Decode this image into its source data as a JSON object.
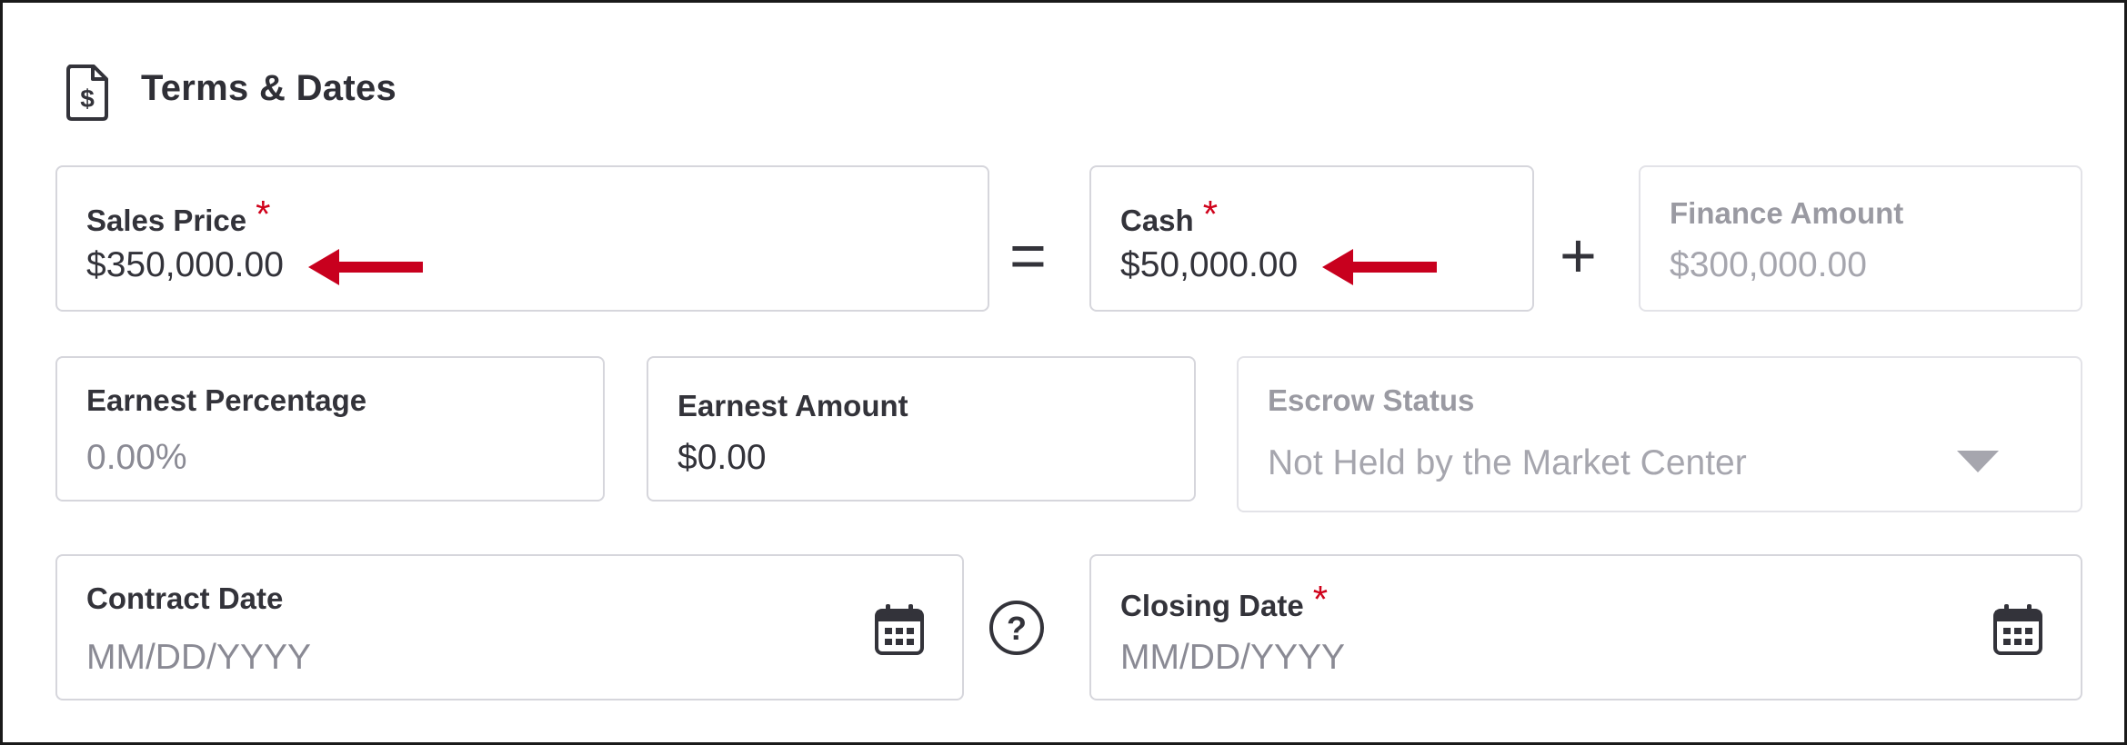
{
  "section": {
    "title": "Terms & Dates",
    "icon": "document-dollar-icon"
  },
  "sales_price": {
    "label": "Sales Price",
    "required_mark": "*",
    "value": "$350,000.00"
  },
  "equals_sign": "=",
  "cash": {
    "label": "Cash",
    "required_mark": "*",
    "value": "$50,000.00"
  },
  "plus_sign": "+",
  "finance_amount": {
    "label": "Finance Amount",
    "value": "$300,000.00"
  },
  "earnest_percentage": {
    "label": "Earnest Percentage",
    "value": "0.00%"
  },
  "earnest_amount": {
    "label": "Earnest Amount",
    "value": "$0.00"
  },
  "escrow_status": {
    "label": "Escrow Status",
    "value": "Not Held by the Market Center"
  },
  "contract_date": {
    "label": "Contract Date",
    "placeholder": "MM/DD/YYYY"
  },
  "help_symbol": "?",
  "closing_date": {
    "label": "Closing Date",
    "required_mark": "*",
    "placeholder": "MM/DD/YYYY"
  },
  "colors": {
    "required": "#d0021b",
    "arrow": "#c8001e",
    "border": "#d6d6dc",
    "text": "#33333a"
  },
  "icons": [
    "document-dollar-icon",
    "red-arrow-icon",
    "calendar-icon",
    "question-circle-icon",
    "chevron-down-icon"
  ]
}
